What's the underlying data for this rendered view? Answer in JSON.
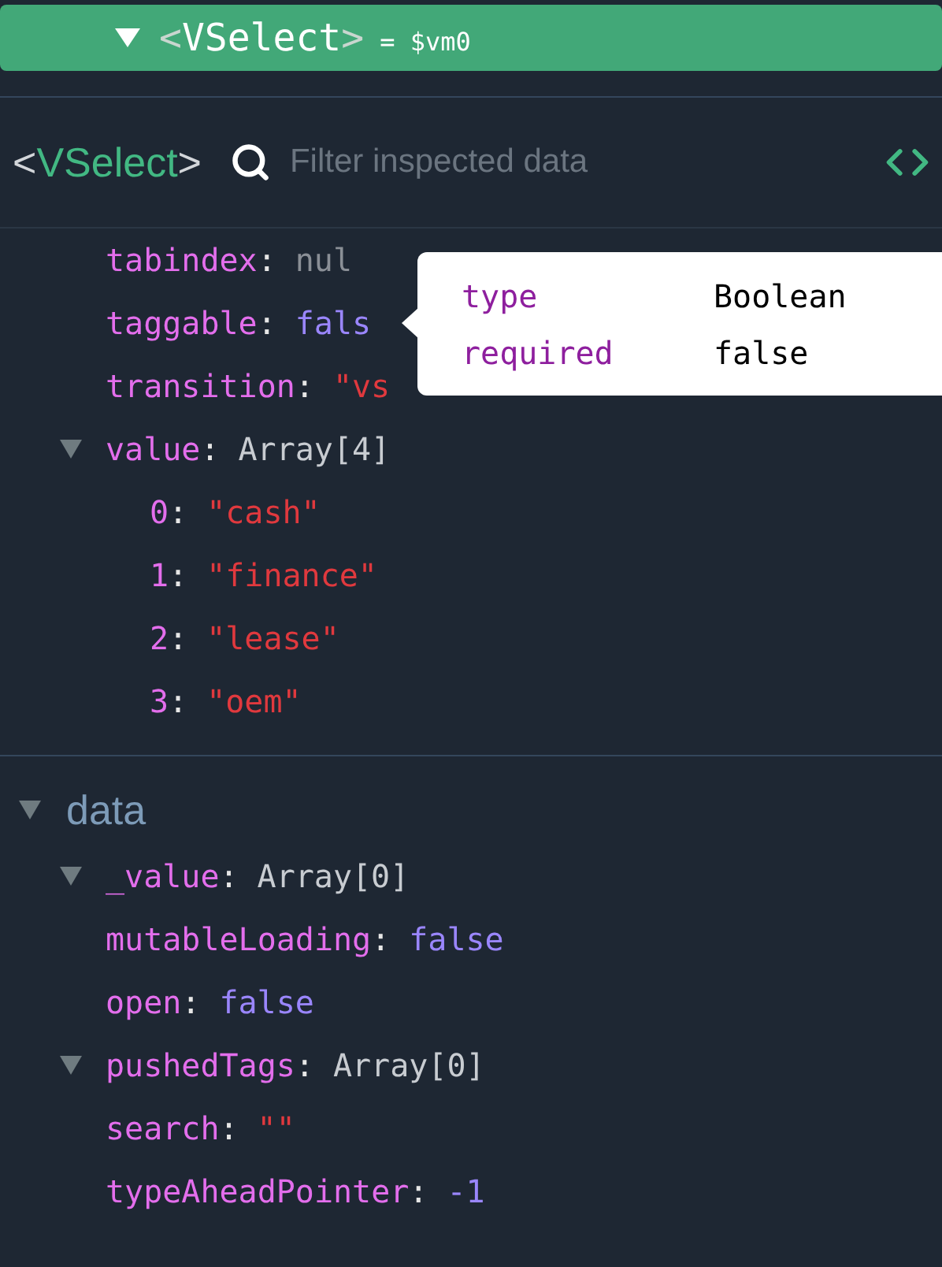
{
  "tree_row": {
    "selected": true,
    "expanded": true,
    "open_bracket": "<",
    "tag": "VSelect",
    "close_bracket": ">",
    "ref": "= $vm0"
  },
  "inspector": {
    "open_bracket": "<",
    "name": "VSelect",
    "close_bracket": ">",
    "search": {
      "placeholder": "Filter inspected data"
    }
  },
  "props": [
    {
      "key": "tabindex",
      "colon": ":",
      "value": "nul",
      "kind": "null"
    },
    {
      "key": "taggable",
      "colon": ":",
      "value": "fals",
      "kind": "boolean"
    },
    {
      "key": "transition",
      "colon": ":",
      "value": "\"vs",
      "kind": "string"
    },
    {
      "key": "value",
      "colon": ":",
      "value": "Array[4]",
      "kind": "array",
      "expanded": true,
      "children": [
        {
          "key": "0",
          "colon": ":",
          "value": "\"cash\"",
          "kind": "string"
        },
        {
          "key": "1",
          "colon": ":",
          "value": "\"finance\"",
          "kind": "string"
        },
        {
          "key": "2",
          "colon": ":",
          "value": "\"lease\"",
          "kind": "string"
        },
        {
          "key": "3",
          "colon": ":",
          "value": "\"oem\"",
          "kind": "string"
        }
      ]
    }
  ],
  "sections": [
    {
      "title": "data",
      "expanded": true,
      "rows": [
        {
          "key": "_value",
          "colon": ":",
          "value": "Array[0]",
          "kind": "array",
          "expanded": true
        },
        {
          "key": "mutableLoading",
          "colon": ":",
          "value": "false",
          "kind": "boolean"
        },
        {
          "key": "open",
          "colon": ":",
          "value": "false",
          "kind": "boolean"
        },
        {
          "key": "pushedTags",
          "colon": ":",
          "value": "Array[0]",
          "kind": "array",
          "expanded": true
        },
        {
          "key": "search",
          "colon": ":",
          "value": "\"\"",
          "kind": "string"
        },
        {
          "key": "typeAheadPointer",
          "colon": ":",
          "value": "-1",
          "kind": "number"
        }
      ]
    }
  ],
  "tooltip": {
    "rows": [
      {
        "key": "type",
        "value": "Boolean"
      },
      {
        "key": "required",
        "value": "false"
      }
    ]
  }
}
